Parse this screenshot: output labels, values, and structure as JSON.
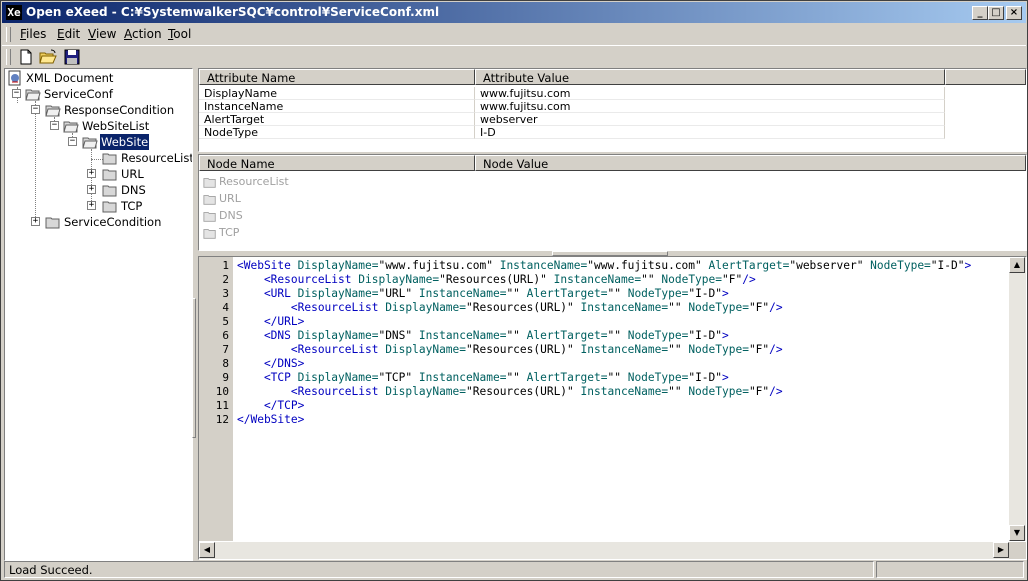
{
  "window": {
    "title": "Open eXeed - C:¥SystemwalkerSQC¥control¥ServiceConf.xml",
    "app_icon": "Xe",
    "buttons": {
      "minimize": "_",
      "maximize": "□",
      "close": "×"
    }
  },
  "menu": [
    {
      "label": "Files",
      "mnemonic": "F"
    },
    {
      "label": "Edit",
      "mnemonic": "E"
    },
    {
      "label": "View",
      "mnemonic": "V"
    },
    {
      "label": "Action",
      "mnemonic": "A"
    },
    {
      "label": "Tool",
      "mnemonic": "T"
    }
  ],
  "toolbar": {
    "icons": [
      "new-file-icon",
      "open-folder-icon",
      "save-icon"
    ]
  },
  "tree": {
    "root": "XML Document",
    "nodes": [
      {
        "label": "ServiceConf",
        "expander": "−"
      },
      {
        "label": "ResponseCondition",
        "expander": "−"
      },
      {
        "label": "WebSiteList",
        "expander": "−"
      },
      {
        "label": "WebSite",
        "expander": "−",
        "selected": true
      },
      {
        "label": "ResourceList",
        "expander": ""
      },
      {
        "label": "URL",
        "expander": "+"
      },
      {
        "label": "DNS",
        "expander": "+"
      },
      {
        "label": "TCP",
        "expander": "+"
      },
      {
        "label": "ServiceCondition",
        "expander": "+"
      }
    ]
  },
  "attributes": {
    "headers": [
      "Attribute Name",
      "Attribute Value"
    ],
    "rows": [
      [
        "DisplayName",
        "www.fujitsu.com"
      ],
      [
        "InstanceName",
        "www.fujitsu.com"
      ],
      [
        "AlertTarget",
        "webserver"
      ],
      [
        "NodeType",
        "I-D"
      ]
    ]
  },
  "nodes_panel": {
    "headers": [
      "Node Name",
      "Node Value"
    ],
    "items": [
      "ResourceList",
      "URL",
      "DNS",
      "TCP"
    ]
  },
  "editor": {
    "line_numbers": [
      "1",
      "2",
      "3",
      "4",
      "5",
      "6",
      "7",
      "8",
      "9",
      "10",
      "11",
      "12"
    ],
    "lines": [
      [
        [
          "t",
          "<WebSite "
        ],
        [
          "a",
          "DisplayName="
        ],
        [
          "v",
          "\"www.fujitsu.com\" "
        ],
        [
          "a",
          "InstanceName="
        ],
        [
          "v",
          "\"www.fujitsu.com\" "
        ],
        [
          "a",
          "AlertTarget="
        ],
        [
          "v",
          "\"webserver\" "
        ],
        [
          "a",
          "NodeType="
        ],
        [
          "v",
          "\"I-D\""
        ],
        [
          "t",
          ">"
        ]
      ],
      [
        [
          "t",
          "    <ResourceList "
        ],
        [
          "a",
          "DisplayName="
        ],
        [
          "v",
          "\"Resources(URL)\" "
        ],
        [
          "a",
          "InstanceName="
        ],
        [
          "v",
          "\"\" "
        ],
        [
          "a",
          "NodeType="
        ],
        [
          "v",
          "\"F\""
        ],
        [
          "t",
          "/>"
        ]
      ],
      [
        [
          "t",
          "    <URL "
        ],
        [
          "a",
          "DisplayName="
        ],
        [
          "v",
          "\"URL\" "
        ],
        [
          "a",
          "InstanceName="
        ],
        [
          "v",
          "\"\" "
        ],
        [
          "a",
          "AlertTarget="
        ],
        [
          "v",
          "\"\" "
        ],
        [
          "a",
          "NodeType="
        ],
        [
          "v",
          "\"I-D\""
        ],
        [
          "t",
          ">"
        ]
      ],
      [
        [
          "t",
          "        <ResourceList "
        ],
        [
          "a",
          "DisplayName="
        ],
        [
          "v",
          "\"Resources(URL)\" "
        ],
        [
          "a",
          "InstanceName="
        ],
        [
          "v",
          "\"\" "
        ],
        [
          "a",
          "NodeType="
        ],
        [
          "v",
          "\"F\""
        ],
        [
          "t",
          "/>"
        ]
      ],
      [
        [
          "t",
          "    </URL>"
        ]
      ],
      [
        [
          "t",
          "    <DNS "
        ],
        [
          "a",
          "DisplayName="
        ],
        [
          "v",
          "\"DNS\" "
        ],
        [
          "a",
          "InstanceName="
        ],
        [
          "v",
          "\"\" "
        ],
        [
          "a",
          "AlertTarget="
        ],
        [
          "v",
          "\"\" "
        ],
        [
          "a",
          "NodeType="
        ],
        [
          "v",
          "\"I-D\""
        ],
        [
          "t",
          ">"
        ]
      ],
      [
        [
          "t",
          "        <ResourceList "
        ],
        [
          "a",
          "DisplayName="
        ],
        [
          "v",
          "\"Resources(URL)\" "
        ],
        [
          "a",
          "InstanceName="
        ],
        [
          "v",
          "\"\" "
        ],
        [
          "a",
          "NodeType="
        ],
        [
          "v",
          "\"F\""
        ],
        [
          "t",
          "/>"
        ]
      ],
      [
        [
          "t",
          "    </DNS>"
        ]
      ],
      [
        [
          "t",
          "    <TCP "
        ],
        [
          "a",
          "DisplayName="
        ],
        [
          "v",
          "\"TCP\" "
        ],
        [
          "a",
          "InstanceName="
        ],
        [
          "v",
          "\"\" "
        ],
        [
          "a",
          "AlertTarget="
        ],
        [
          "v",
          "\"\" "
        ],
        [
          "a",
          "NodeType="
        ],
        [
          "v",
          "\"I-D\""
        ],
        [
          "t",
          ">"
        ]
      ],
      [
        [
          "t",
          "        <ResourceList "
        ],
        [
          "a",
          "DisplayName="
        ],
        [
          "v",
          "\"Resources(URL)\" "
        ],
        [
          "a",
          "InstanceName="
        ],
        [
          "v",
          "\"\" "
        ],
        [
          "a",
          "NodeType="
        ],
        [
          "v",
          "\"F\""
        ],
        [
          "t",
          "/>"
        ]
      ],
      [
        [
          "t",
          "    </TCP>"
        ]
      ],
      [
        [
          "t",
          "</WebSite>"
        ]
      ]
    ]
  },
  "status": {
    "message": "Load Succeed."
  },
  "colors": {
    "title_start": "#0a246a",
    "title_end": "#a6caf0",
    "tag": "#0000c0",
    "attr": "#006060",
    "selection": "#0a246a"
  }
}
